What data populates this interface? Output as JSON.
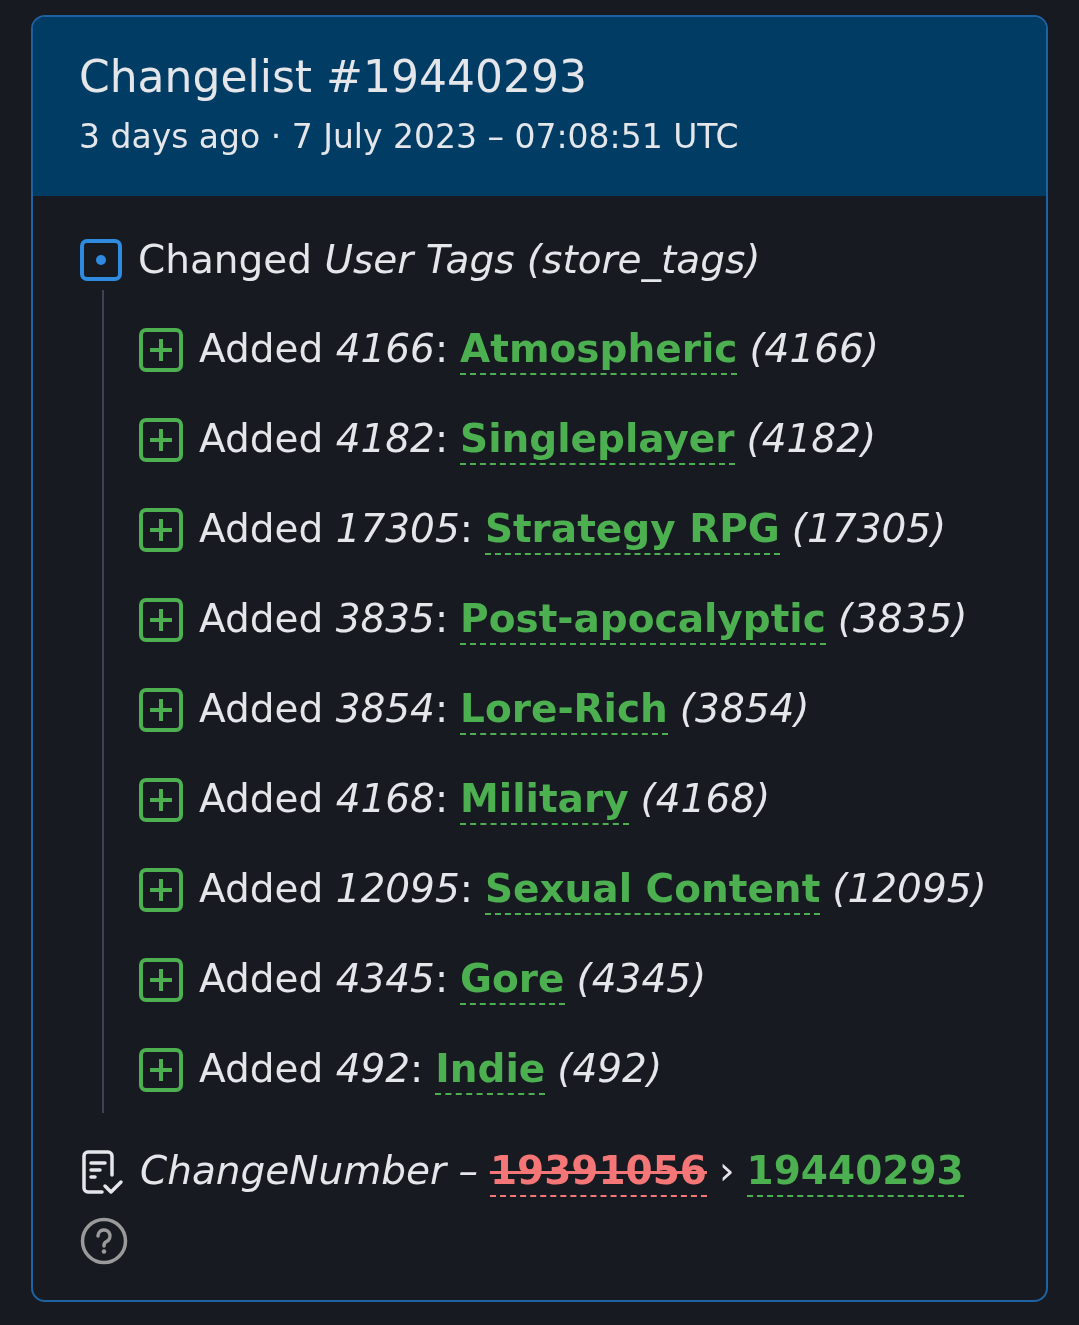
{
  "header": {
    "title": "Changelist #19440293",
    "subtitle": "3 days ago · 7 July 2023 – 07:08:51 UTC"
  },
  "change": {
    "summary": "Changed *User Tags (store_tags)*",
    "items": [
      {
        "label": "Added *4166*:",
        "tag": "Atmospheric",
        "tag_id": "(4166)"
      },
      {
        "label": "Added *4182*:",
        "tag": "Singleplayer",
        "tag_id": "(4182)"
      },
      {
        "label": "Added *17305*:",
        "tag": "Strategy RPG",
        "tag_id": "(17305)"
      },
      {
        "label": "Added *3835*:",
        "tag": "Post-apocalyptic",
        "tag_id": "(3835)"
      },
      {
        "label": "Added *3854*:",
        "tag": "Lore-Rich",
        "tag_id": "(3854)"
      },
      {
        "label": "Added *4168*:",
        "tag": "Military",
        "tag_id": "(4168)"
      },
      {
        "label": "Added *12095*:",
        "tag": "Sexual Content",
        "tag_id": "(12095)"
      },
      {
        "label": "Added *4345*:",
        "tag": "Gore",
        "tag_id": "(4345)"
      },
      {
        "label": "Added *492*:",
        "tag": "Indie",
        "tag_id": "(492)"
      }
    ]
  },
  "change_number": {
    "label": "ChangeNumber –",
    "old_value": "19391056",
    "separator": "›",
    "new_value": "19440293"
  }
}
